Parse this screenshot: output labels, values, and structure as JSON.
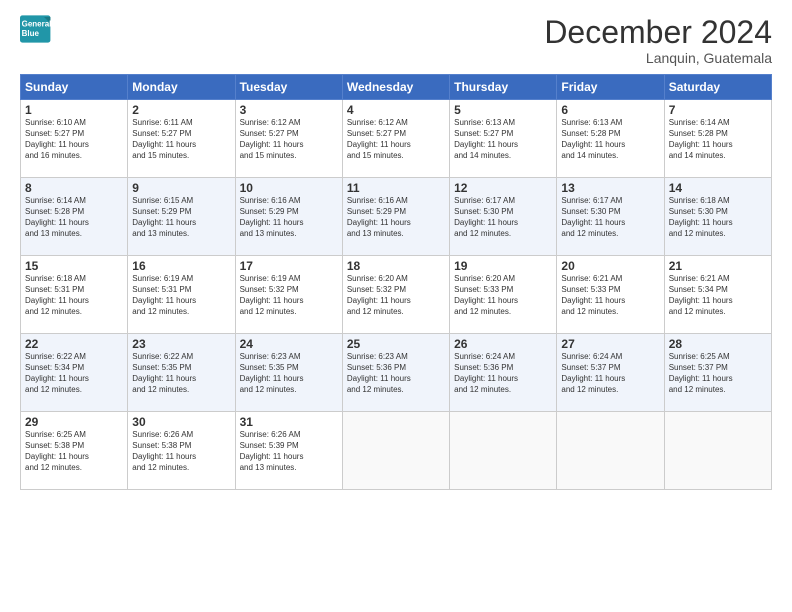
{
  "logo": {
    "line1": "General",
    "line2": "Blue"
  },
  "title": "December 2024",
  "location": "Lanquin, Guatemala",
  "days_of_week": [
    "Sunday",
    "Monday",
    "Tuesday",
    "Wednesday",
    "Thursday",
    "Friday",
    "Saturday"
  ],
  "weeks": [
    [
      {
        "day": "1",
        "info": "Sunrise: 6:10 AM\nSunset: 5:27 PM\nDaylight: 11 hours\nand 16 minutes."
      },
      {
        "day": "2",
        "info": "Sunrise: 6:11 AM\nSunset: 5:27 PM\nDaylight: 11 hours\nand 15 minutes."
      },
      {
        "day": "3",
        "info": "Sunrise: 6:12 AM\nSunset: 5:27 PM\nDaylight: 11 hours\nand 15 minutes."
      },
      {
        "day": "4",
        "info": "Sunrise: 6:12 AM\nSunset: 5:27 PM\nDaylight: 11 hours\nand 15 minutes."
      },
      {
        "day": "5",
        "info": "Sunrise: 6:13 AM\nSunset: 5:27 PM\nDaylight: 11 hours\nand 14 minutes."
      },
      {
        "day": "6",
        "info": "Sunrise: 6:13 AM\nSunset: 5:28 PM\nDaylight: 11 hours\nand 14 minutes."
      },
      {
        "day": "7",
        "info": "Sunrise: 6:14 AM\nSunset: 5:28 PM\nDaylight: 11 hours\nand 14 minutes."
      }
    ],
    [
      {
        "day": "8",
        "info": "Sunrise: 6:14 AM\nSunset: 5:28 PM\nDaylight: 11 hours\nand 13 minutes."
      },
      {
        "day": "9",
        "info": "Sunrise: 6:15 AM\nSunset: 5:29 PM\nDaylight: 11 hours\nand 13 minutes."
      },
      {
        "day": "10",
        "info": "Sunrise: 6:16 AM\nSunset: 5:29 PM\nDaylight: 11 hours\nand 13 minutes."
      },
      {
        "day": "11",
        "info": "Sunrise: 6:16 AM\nSunset: 5:29 PM\nDaylight: 11 hours\nand 13 minutes."
      },
      {
        "day": "12",
        "info": "Sunrise: 6:17 AM\nSunset: 5:30 PM\nDaylight: 11 hours\nand 12 minutes."
      },
      {
        "day": "13",
        "info": "Sunrise: 6:17 AM\nSunset: 5:30 PM\nDaylight: 11 hours\nand 12 minutes."
      },
      {
        "day": "14",
        "info": "Sunrise: 6:18 AM\nSunset: 5:30 PM\nDaylight: 11 hours\nand 12 minutes."
      }
    ],
    [
      {
        "day": "15",
        "info": "Sunrise: 6:18 AM\nSunset: 5:31 PM\nDaylight: 11 hours\nand 12 minutes."
      },
      {
        "day": "16",
        "info": "Sunrise: 6:19 AM\nSunset: 5:31 PM\nDaylight: 11 hours\nand 12 minutes."
      },
      {
        "day": "17",
        "info": "Sunrise: 6:19 AM\nSunset: 5:32 PM\nDaylight: 11 hours\nand 12 minutes."
      },
      {
        "day": "18",
        "info": "Sunrise: 6:20 AM\nSunset: 5:32 PM\nDaylight: 11 hours\nand 12 minutes."
      },
      {
        "day": "19",
        "info": "Sunrise: 6:20 AM\nSunset: 5:33 PM\nDaylight: 11 hours\nand 12 minutes."
      },
      {
        "day": "20",
        "info": "Sunrise: 6:21 AM\nSunset: 5:33 PM\nDaylight: 11 hours\nand 12 minutes."
      },
      {
        "day": "21",
        "info": "Sunrise: 6:21 AM\nSunset: 5:34 PM\nDaylight: 11 hours\nand 12 minutes."
      }
    ],
    [
      {
        "day": "22",
        "info": "Sunrise: 6:22 AM\nSunset: 5:34 PM\nDaylight: 11 hours\nand 12 minutes."
      },
      {
        "day": "23",
        "info": "Sunrise: 6:22 AM\nSunset: 5:35 PM\nDaylight: 11 hours\nand 12 minutes."
      },
      {
        "day": "24",
        "info": "Sunrise: 6:23 AM\nSunset: 5:35 PM\nDaylight: 11 hours\nand 12 minutes."
      },
      {
        "day": "25",
        "info": "Sunrise: 6:23 AM\nSunset: 5:36 PM\nDaylight: 11 hours\nand 12 minutes."
      },
      {
        "day": "26",
        "info": "Sunrise: 6:24 AM\nSunset: 5:36 PM\nDaylight: 11 hours\nand 12 minutes."
      },
      {
        "day": "27",
        "info": "Sunrise: 6:24 AM\nSunset: 5:37 PM\nDaylight: 11 hours\nand 12 minutes."
      },
      {
        "day": "28",
        "info": "Sunrise: 6:25 AM\nSunset: 5:37 PM\nDaylight: 11 hours\nand 12 minutes."
      }
    ],
    [
      {
        "day": "29",
        "info": "Sunrise: 6:25 AM\nSunset: 5:38 PM\nDaylight: 11 hours\nand 12 minutes."
      },
      {
        "day": "30",
        "info": "Sunrise: 6:26 AM\nSunset: 5:38 PM\nDaylight: 11 hours\nand 12 minutes."
      },
      {
        "day": "31",
        "info": "Sunrise: 6:26 AM\nSunset: 5:39 PM\nDaylight: 11 hours\nand 13 minutes."
      },
      null,
      null,
      null,
      null
    ]
  ]
}
